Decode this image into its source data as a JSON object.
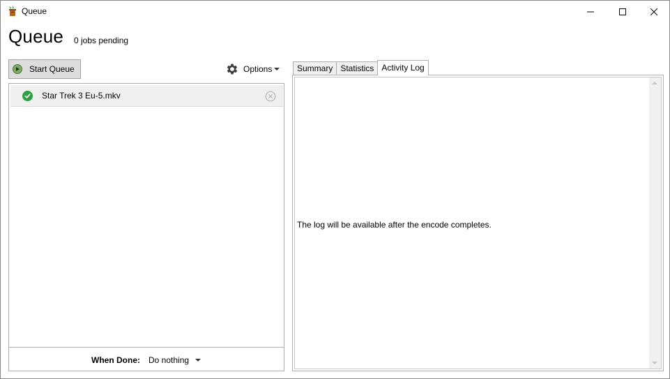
{
  "window": {
    "title": "Queue"
  },
  "header": {
    "heading": "Queue",
    "pending": "0 jobs pending"
  },
  "toolbar": {
    "start_label": "Start Queue",
    "options_label": "Options"
  },
  "queue": {
    "items": [
      {
        "name": "Star Trek 3 Eu-5.mkv",
        "status": "completed"
      }
    ]
  },
  "when_done": {
    "label": "When Done:",
    "value": "Do nothing"
  },
  "tabs": [
    {
      "label": "Summary",
      "active": false
    },
    {
      "label": "Statistics",
      "active": false
    },
    {
      "label": "Activity Log",
      "active": true
    }
  ],
  "activity_log": {
    "message": "The log will be available after the encode completes."
  },
  "colors": {
    "success": "#2ea043",
    "play_button": "#7fa86a"
  }
}
